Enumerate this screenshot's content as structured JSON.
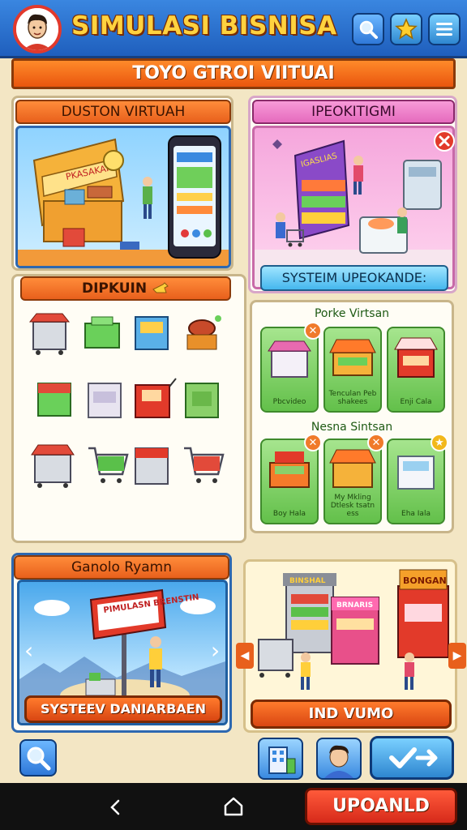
{
  "header": {
    "title": "SIMULASI BISNISA",
    "buttons": [
      {
        "icon": "search-icon"
      },
      {
        "icon": "star-icon"
      },
      {
        "icon": "menu-icon"
      }
    ]
  },
  "banner": {
    "text": "TOYO GTROI VIITUAI"
  },
  "panels": {
    "store_virtual": {
      "title": "DUSTON VIRTUAH",
      "sign": "PKASAKAI"
    },
    "equipment": {
      "title": "IPEOKITIGMI",
      "sign": "IGASLIAS",
      "button": "SYSTEIM UPEOKANDE:"
    },
    "pickup": {
      "title": "DIPKUIN"
    },
    "cards": {
      "section1": "Porke Virtsan",
      "section2": "Nesna Sintsan",
      "items": [
        {
          "label": "Pbcvideo"
        },
        {
          "label": "Tenculan Peb shakees"
        },
        {
          "label": "Enji Cala"
        },
        {
          "label": "Boy Hala"
        },
        {
          "label": "My Mkling Dtlesk tsatn ess"
        },
        {
          "label": "Eha Iala"
        }
      ]
    },
    "carousel": {
      "title": "Ganolo Ryamn",
      "sign": "PIMULASN BRENSTIN",
      "button": "SYSTEEV DANIARBAEN"
    },
    "market": {
      "signs": [
        "BINSHAL",
        "BRNARIS",
        "BONGAN"
      ],
      "button": "IND VUMO"
    }
  },
  "bottom": {
    "upload_label": "UPOANLD"
  },
  "colors": {
    "header": "#2a72d0",
    "accent_orange": "#ee6a1c",
    "card_green": "#7ad160",
    "title_yellow": "#ffd23f"
  }
}
